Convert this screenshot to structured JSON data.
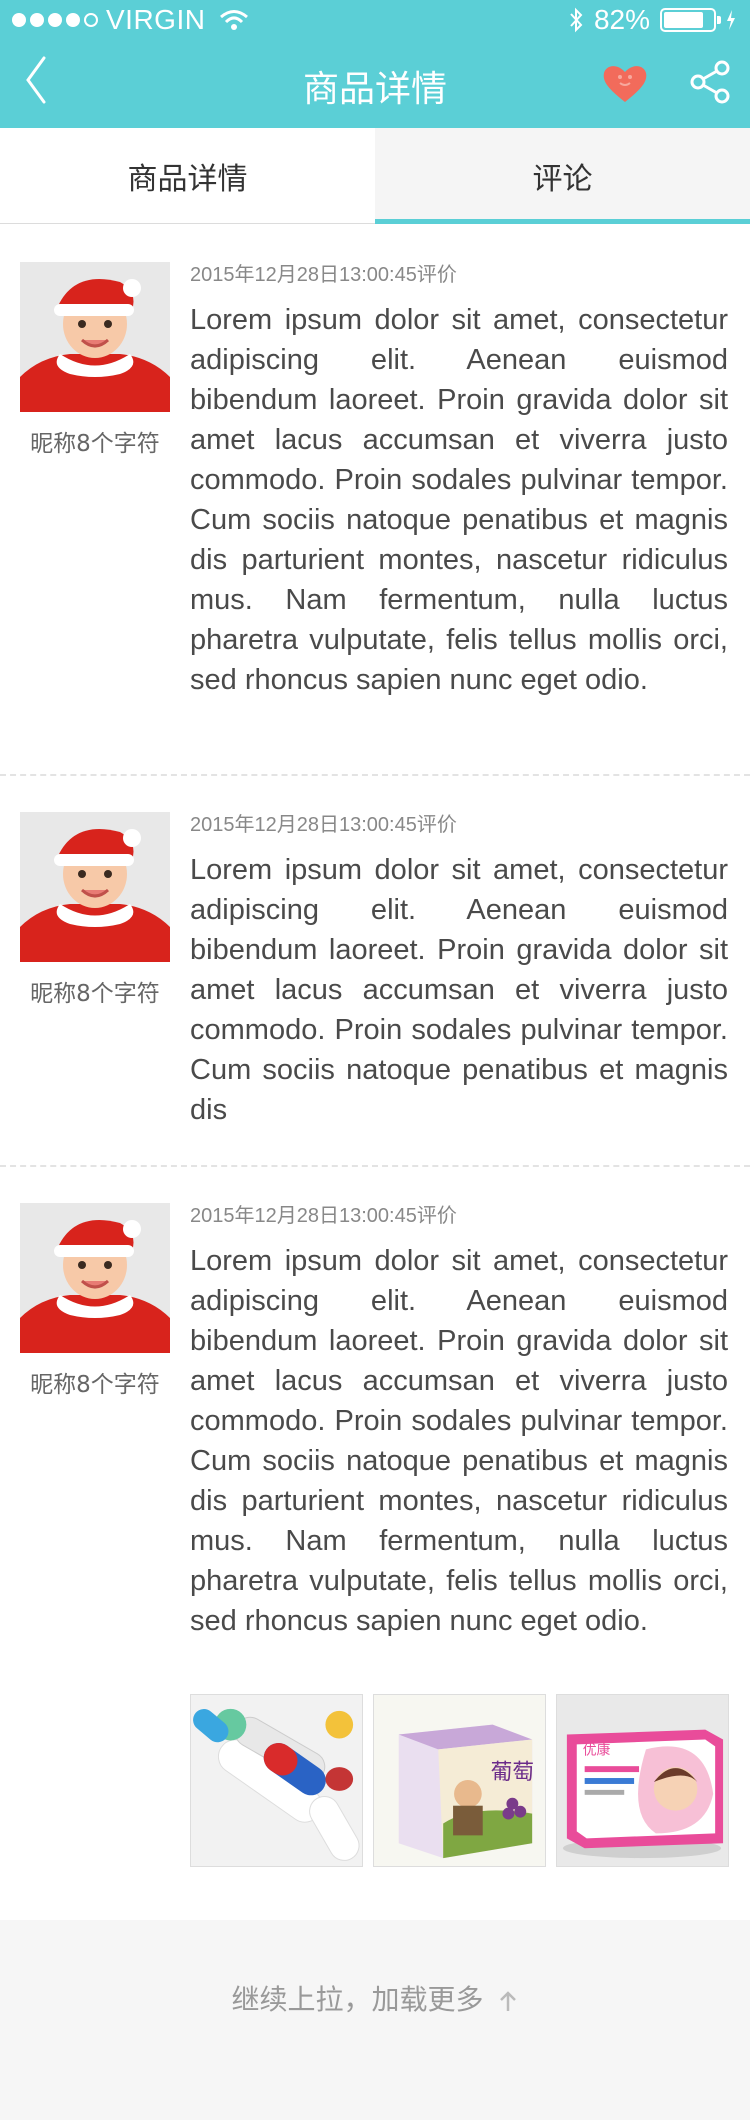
{
  "status_bar": {
    "carrier": "VIRGIN",
    "battery_percent": "82%",
    "battery_level": 0.82
  },
  "navbar": {
    "title": "商品详情"
  },
  "tabs": [
    {
      "label": "商品详情",
      "active": false
    },
    {
      "label": "评论",
      "active": true
    }
  ],
  "reviews": [
    {
      "nickname": "昵称8个字符",
      "time": "2015年12月28日13:00:45评价",
      "text": "Lorem ipsum dolor sit amet, consectetur adipiscing elit. Aenean euismod bibendum laoreet. Proin gravida dolor sit amet lacus accumsan et viverra justo commodo. Proin sodales pulvinar tempor. Cum sociis natoque penatibus et magnis dis parturient montes, nascetur ridiculus mus. Nam fermentum, nulla luctus pharetra vulputate, felis tellus mollis orci, sed rhoncus sapien nunc eget odio."
    },
    {
      "nickname": "昵称8个字符",
      "time": "2015年12月28日13:00:45评价",
      "text": "Lorem ipsum dolor sit amet, consectetur adipiscing elit. Aenean euismod bibendum laoreet. Proin gravida dolor sit amet lacus accumsan et viverra justo commodo. Proin sodales pulvinar tempor. Cum sociis natoque penatibus et magnis dis"
    },
    {
      "nickname": "昵称8个字符",
      "time": "2015年12月28日13:00:45评价",
      "text": "Lorem ipsum dolor sit amet, consectetur adipiscing elit. Aenean euismod bibendum laoreet. Proin gravida dolor sit amet lacus accumsan et viverra justo commodo. Proin sodales pulvinar tempor. Cum sociis natoque penatibus et magnis dis parturient montes, nascetur ridiculus mus. Nam fermentum, nulla luctus pharetra vulputate, felis tellus mollis orci, sed rhoncus sapien nunc eget odio.",
      "images": [
        {
          "icon": "pills-photo"
        },
        {
          "icon": "grape-box-photo",
          "box_text": "葡萄"
        },
        {
          "icon": "baby-product-box-photo",
          "box_text": "优康"
        }
      ]
    }
  ],
  "footer": {
    "load_more": "继续上拉，加载更多"
  },
  "colors": {
    "accent": "#5bcfd6",
    "heart": "#f26b5b"
  }
}
